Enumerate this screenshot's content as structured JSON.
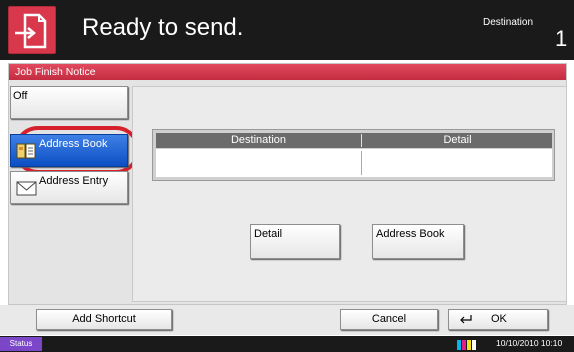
{
  "header": {
    "title": "Ready to send.",
    "destination_label": "Destination",
    "destination_count": "1",
    "send_icon": "document-send-icon"
  },
  "panel": {
    "title": "Job Finish Notice",
    "buttons": {
      "off": "Off",
      "address_book": "Address Book",
      "address_entry": "Address Entry"
    },
    "address_book_icon": "address-book-icon",
    "address_entry_icon": "envelope-icon",
    "table": {
      "columns": [
        "Destination",
        "Detail"
      ],
      "rows": [
        [
          "",
          ""
        ]
      ]
    },
    "detail_button": "Detail",
    "address_book_button": "Address Book"
  },
  "bottom": {
    "add_shortcut": "Add Shortcut",
    "cancel": "Cancel",
    "ok": "OK",
    "ok_icon": "return-arrow-icon"
  },
  "status": {
    "status_label": "Status",
    "toner_icon": "toner-level-icon",
    "datetime": "10/10/2010  10:10"
  },
  "colors": {
    "accent_red": "#d9374b",
    "selected_blue": "#1f63d6",
    "status_purple": "#7b47c8",
    "header_bg": "#1a1a1a"
  }
}
